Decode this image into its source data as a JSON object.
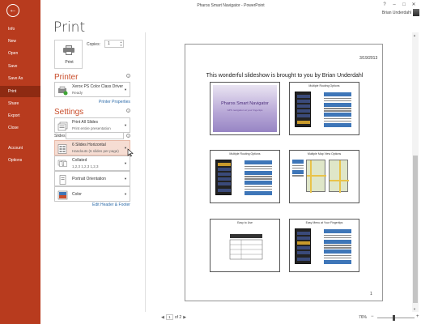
{
  "window": {
    "title": "Pharos Smart Navigator - PowerPoint",
    "user": "Brian Underdahl",
    "controls": [
      "?",
      "–",
      "□",
      "✕"
    ]
  },
  "nav": {
    "back_icon": "←",
    "items": [
      {
        "label": "Info"
      },
      {
        "label": "New"
      },
      {
        "label": "Open"
      },
      {
        "label": "Save"
      },
      {
        "label": "Save As"
      },
      {
        "label": "Print",
        "active": true
      },
      {
        "label": "Share"
      },
      {
        "label": "Export"
      },
      {
        "label": "Close"
      },
      {
        "label": "Account"
      },
      {
        "label": "Options"
      }
    ]
  },
  "print": {
    "heading": "Print",
    "button_label": "Print",
    "copies_label": "Copies:",
    "copies_value": "1"
  },
  "printer": {
    "heading": "Printer",
    "name": "Xerox PS Color Class Driver",
    "status": "Ready",
    "properties_link": "Printer Properties"
  },
  "settings": {
    "heading": "Settings",
    "range": {
      "title": "Print All Slides",
      "subtitle": "Print entire presentation"
    },
    "slides_label": "Slides:",
    "slides_value": "",
    "layout": {
      "title": "6 Slides Horizontal",
      "subtitle": "Handouts (6 slides per page)"
    },
    "collation": {
      "title": "Collated",
      "subtitle": "1,2,3    1,2,3    1,2,3"
    },
    "orientation": {
      "title": "Portrait Orientation"
    },
    "color": {
      "title": "Color"
    },
    "header_footer_link": "Edit Header & Footer"
  },
  "preview": {
    "date": "3/19/2013",
    "header": "This wonderful slideshow is brought to you by Brian Underdahl",
    "page_number": "1",
    "slides": [
      {
        "title": "Pharos Smart Navigator",
        "subtitle": "GPS navigation at your fingertips"
      },
      {
        "title": "Multiple Routing Options"
      },
      {
        "title": "Multiple Routing Options"
      },
      {
        "title": "Multiple Map View Options"
      },
      {
        "title": "Easy to Use"
      },
      {
        "title": "Easy Menu at Your Fingertips"
      }
    ]
  },
  "pager": {
    "current": "1",
    "total_label": "of 2"
  },
  "zoom": {
    "level": "76%",
    "fraction": 0.45
  },
  "colors": {
    "nav_bg": "#b83b1e",
    "nav_active": "#8e2a12",
    "accent": "#c94d2b",
    "link": "#2b6aa8",
    "highlight": "#f6ddd3"
  }
}
